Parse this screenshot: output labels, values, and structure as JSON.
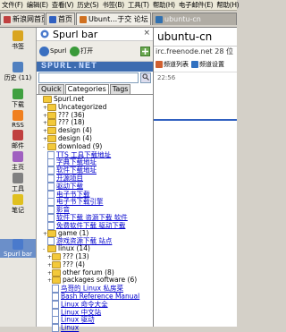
{
  "menubar": [
    "文件(F)",
    "编辑(E)",
    "查看(V)",
    "历史(S)",
    "书签(B)",
    "工具(T)",
    "帮助(H)",
    "电子邮件(E)",
    "帮助(H)"
  ],
  "tabs": [
    {
      "label": "新浪网首页",
      "favicon_color": "#c04040"
    },
    {
      "label": "首页",
      "favicon_color": "#3060c0"
    },
    {
      "label": "Ubunt…于交 论坛 -",
      "favicon_color": "#d07020",
      "close": "×"
    },
    {
      "label": "ubuntu-cn",
      "favicon_color": "#3070b0"
    }
  ],
  "leftbar": [
    {
      "label": "书签",
      "icon_color": "#d9a520"
    },
    {
      "label": "历史 (11)",
      "icon_color": "#5080c0"
    },
    {
      "label": "下载",
      "icon_color": "#40a040"
    },
    {
      "label": "RSS",
      "icon_color": "#f08020"
    },
    {
      "label": "邮件",
      "icon_color": "#c04040"
    },
    {
      "label": "主页",
      "icon_color": "#a060c0"
    },
    {
      "label": "工具",
      "icon_color": "#808080"
    },
    {
      "label": "笔记",
      "icon_color": "#e0c020"
    },
    {
      "label": "Spurl bar",
      "icon_color": "#4a7acc"
    }
  ],
  "panel": {
    "title": "Spurl bar",
    "toolbar": [
      {
        "label": "Spurl",
        "icon_color": "#3a6fc0"
      },
      {
        "label": "打开",
        "icon_color": "#3a9a3a"
      }
    ],
    "banner": "SPURL.NET",
    "search_placeholder": "",
    "tabs": [
      "Quick",
      "Categories",
      "Tags"
    ],
    "tree": [
      {
        "level": 0,
        "type": "folder",
        "label": "Spurl.net",
        "twisty": ""
      },
      {
        "level": 1,
        "type": "folder",
        "label": "Uncategorized",
        "twisty": "+"
      },
      {
        "level": 1,
        "type": "folder",
        "label": "??? (36)",
        "twisty": "+"
      },
      {
        "level": 1,
        "type": "folder",
        "label": "??? (18)",
        "twisty": "+"
      },
      {
        "level": 1,
        "type": "folder",
        "label": "design (4)",
        "twisty": "+"
      },
      {
        "level": 1,
        "type": "folder",
        "label": "design (4)",
        "twisty": "+"
      },
      {
        "level": 1,
        "type": "folder",
        "label": "download (9)",
        "twisty": "-"
      },
      {
        "level": 2,
        "type": "link",
        "label": "TTS 工具下载地址"
      },
      {
        "level": 2,
        "type": "link",
        "label": "字典下载地址"
      },
      {
        "level": 2,
        "type": "link",
        "label": "软件下载地址"
      },
      {
        "level": 2,
        "type": "link",
        "label": "开源项目"
      },
      {
        "level": 2,
        "type": "link",
        "label": "驱动下载"
      },
      {
        "level": 2,
        "type": "link",
        "label": "电子书下载"
      },
      {
        "level": 2,
        "type": "link",
        "label": "电子书下载引擎"
      },
      {
        "level": 2,
        "type": "link",
        "label": "影音"
      },
      {
        "level": 2,
        "type": "link",
        "label": "软件下载 资源下载 软件"
      },
      {
        "level": 2,
        "type": "link",
        "label": "免费软件下载 驱动下载"
      },
      {
        "level": 1,
        "type": "folder",
        "label": "game (1)",
        "twisty": "+"
      },
      {
        "level": 2,
        "type": "link",
        "label": "游戏资源下载 站点"
      },
      {
        "level": 1,
        "type": "folder",
        "label": "linux (14)",
        "twisty": "-"
      },
      {
        "level": 2,
        "type": "folder",
        "label": "??? (13)",
        "twisty": "+"
      },
      {
        "level": 2,
        "type": "folder",
        "label": "??? (4)",
        "twisty": "+"
      },
      {
        "level": 2,
        "type": "folder",
        "label": "other forum (8)",
        "twisty": "+"
      },
      {
        "level": 2,
        "type": "folder",
        "label": "packages software (6)",
        "twisty": "+"
      },
      {
        "level": 3,
        "type": "link",
        "label": "鸟哥的 Linux 私房菜"
      },
      {
        "level": 3,
        "type": "link",
        "label": "Bash Reference Manual"
      },
      {
        "level": 3,
        "type": "link",
        "label": "Linux 命令大全"
      },
      {
        "level": 3,
        "type": "link",
        "label": "Linux 中文站"
      },
      {
        "level": 3,
        "type": "link",
        "label": "Linux 驱动"
      },
      {
        "level": 3,
        "type": "link",
        "label": "Linux"
      }
    ],
    "close_label": "×"
  },
  "right": {
    "title": "ubuntu-cn",
    "subtitle": "irc.freenode.net  28 位",
    "tools": [
      {
        "label": "频道列表",
        "icon_color": "#d06030"
      },
      {
        "label": "频道设置",
        "icon_color": "#3070c0"
      }
    ],
    "time": "22:56"
  }
}
